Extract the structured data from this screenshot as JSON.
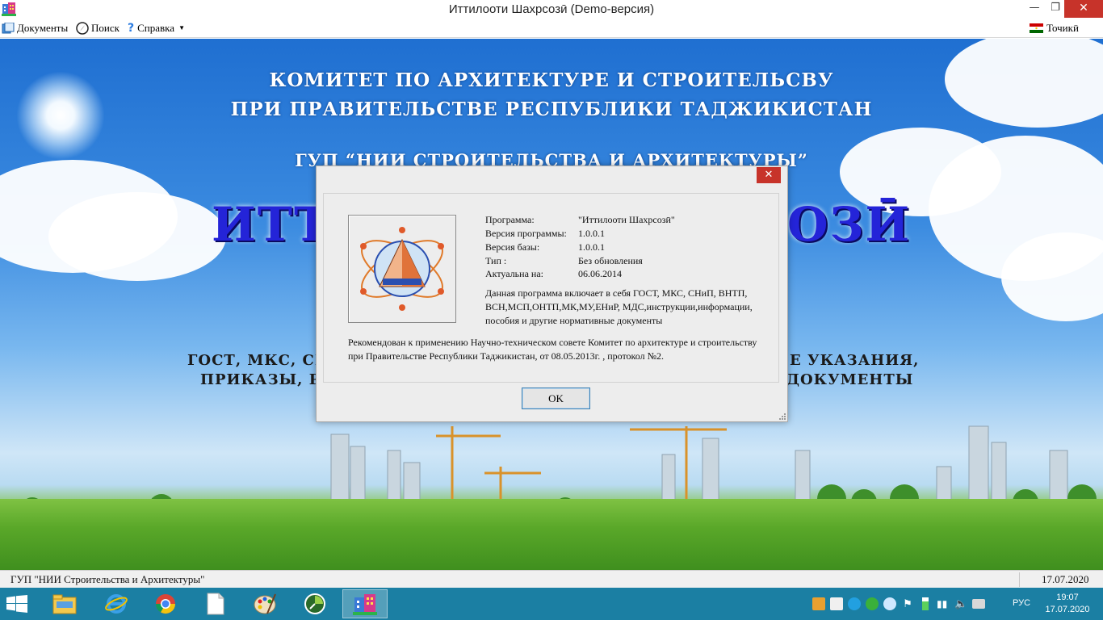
{
  "window": {
    "title": "Иттилооти Шахрсозӣ (Demo-версия)"
  },
  "menu": {
    "documents": "Документы",
    "search": "Поиск",
    "help": "Справка",
    "language": "Точикӣ"
  },
  "background": {
    "line1": "КОМИТЕТ ПО АРХИТЕКТУРЕ И СТРОИТЕЛЬСВУ",
    "line2": "ПРИ ПРАВИТЕЛЬСТВЕ РЕСПУБЛИКИ ТАДЖИКИСТАН",
    "line3": "ГУП “НИИ СТРОИТЕЛЬСТВА И АРХИТЕКТУРЫ”",
    "big_left": "ИТТ",
    "big_right": "ОЗӢ",
    "list1_left": "ГОСТ, МКС, СН",
    "list1_right": "Е УКАЗАНИЯ,",
    "list2_left": "ПРИКАЗЫ, РА",
    "list2_right": "ДОКУМЕНТЫ"
  },
  "dialog": {
    "close_glyph": "✕",
    "info": [
      {
        "label": "Программа:",
        "value": "\"Иттилооти Шахрсозӣ\""
      },
      {
        "label": "Версия программы:",
        "value": "1.0.0.1"
      },
      {
        "label": "Версия базы:",
        "value": "1.0.0.1"
      },
      {
        "label": "Тип :",
        "value": "Без обновления"
      },
      {
        "label": "Актуальна на:",
        "value": "06.06.2014"
      }
    ],
    "description": "Данная программа включает в себя ГОСТ, МКС, СНиП, ВНТП, ВСН,МСП,ОНТП,МК,МУ,ЕНиР, МДС,инструкции,информации, пособия и другие нормативные документы",
    "recommendation": "Рекомендован к применению Научно-техническом совете Комитет по архитектуре и строительству при Правительстве Республики Таджикистан, от 08.05.2013г. , протокол  №2.",
    "ok_label": "OK"
  },
  "status": {
    "left": "ГУП \"НИИ Строительства и Архитектуры\"",
    "right": "17.07.2020"
  },
  "taskbar": {
    "language": "РУС",
    "time": "19:07",
    "date": "17.07.2020"
  },
  "colors": {
    "taskbar": "#1b7fa3",
    "close_button": "#c7332a",
    "big_title": "#2424d8"
  }
}
